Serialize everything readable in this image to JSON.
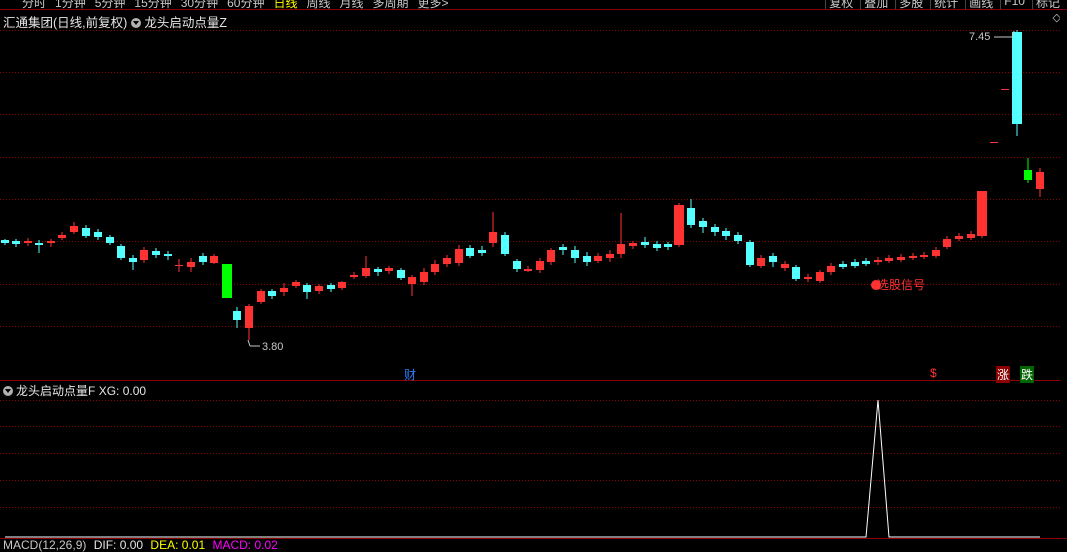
{
  "toolbar": {
    "periods": [
      "分时",
      "1分钟",
      "5分钟",
      "15分钟",
      "30分钟",
      "60分钟",
      "日线",
      "周线",
      "月线",
      "多周期",
      "更多>"
    ],
    "active_period": "日线",
    "buttons": [
      "复权",
      "叠加",
      "多股",
      "统计",
      "画线",
      "F10",
      "标记"
    ]
  },
  "main_panel": {
    "stock_name": "汇通集团",
    "period_note": "(日线,前复权)",
    "indicator_name": "龙头启动点量Z",
    "high_label": "7.45",
    "low_label": "3.80",
    "signal_text": "选股信号",
    "event_markers": {
      "cai": "财",
      "dollar": "$",
      "zhang": "涨",
      "die": "跌"
    },
    "colors": {
      "up": "#ff3232",
      "down": "#54ffff",
      "limit_down": "#00ff00",
      "grid": "#8b0000",
      "signal": "#ff3232"
    }
  },
  "indicator_panel": {
    "title": "龙头启动点量F",
    "xg_label": "XG:",
    "xg_value": "0.00"
  },
  "bottom_legend": {
    "name": "MACD(12,26,9)",
    "dif": "DIF: 0.00",
    "dea": "DEA: 0.01",
    "macd": "MACD: 0.02"
  }
}
